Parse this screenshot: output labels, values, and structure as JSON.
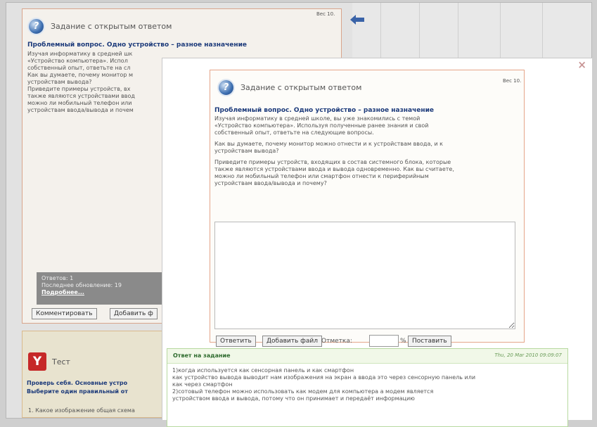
{
  "task_header": "Задание с открытым ответом",
  "weight_label": "Вес 10.",
  "question_title": "Проблемный вопрос. Одно устройство – разное назначение",
  "bg_question_lines": [
    "Изучая информатику в средней шк",
    "«Устройство компьютера». Испол",
    "собственный опыт, ответьте на сл",
    "Как вы думаете, почему монитор м",
    "устройствам вывода?",
    "Приведите примеры устройств, вх",
    "также являются устройствами ввод",
    "можно ли мобильный телефон или",
    "устройствам ввода/вывода и почем"
  ],
  "stats": {
    "answers": "Ответов: 1",
    "last": "Последнее обновление: 19",
    "details": "Подробнее..."
  },
  "bg_buttons": {
    "comment": "Комментировать",
    "add_file": "Добавить ф"
  },
  "test_card": {
    "title": "Тест",
    "heading1": "Проверь себя. Основные устро",
    "heading2": "Выберите один правильный от",
    "item": "1. Какое изображение общая схема"
  },
  "modal": {
    "close": "×",
    "intro": [
      "Изучая информатику в средней школе, вы уже знакомились с темой",
      "«Устройство компьютера». Используя полученные ранее знания и свой",
      "собственный опыт, ответьте на следующие вопросы."
    ],
    "question1": [
      "Как вы думаете, почему монитор можно отнести и к устройствам ввода, и к",
      "устройствам вывода?"
    ],
    "question2": [
      "Приведите примеры устройств, входящих в состав системного блока, которые",
      "также являются устройствами ввода и вывода одновременно. Как вы считаете,",
      "можно ли мобильный телефон или смартфон отнести к периферийным",
      "устройствам ввода/вывода и почему?"
    ],
    "answer_value": "",
    "buttons": {
      "answer": "Ответить",
      "add_file": "Добавить файл",
      "grade_label": "Отметка:",
      "grade_value": "",
      "percent": "%",
      "set": "Поставить"
    }
  },
  "answer_panel": {
    "title": "Ответ на задание",
    "date": "Thu, 20 Mar 2010 09:09:07",
    "lines": [
      "1)когда используется как сенсорная панель и как смартфон",
      "как устройство вывода выводит нам изображения на экран а ввода это через сенсорную панель или",
      "как через смартфон",
      "2)сотовый телефон можно использовать как модем для компьютера а модем является",
      "устройством ввода и вывода, потому что он принимает и передаёт информацию"
    ]
  }
}
